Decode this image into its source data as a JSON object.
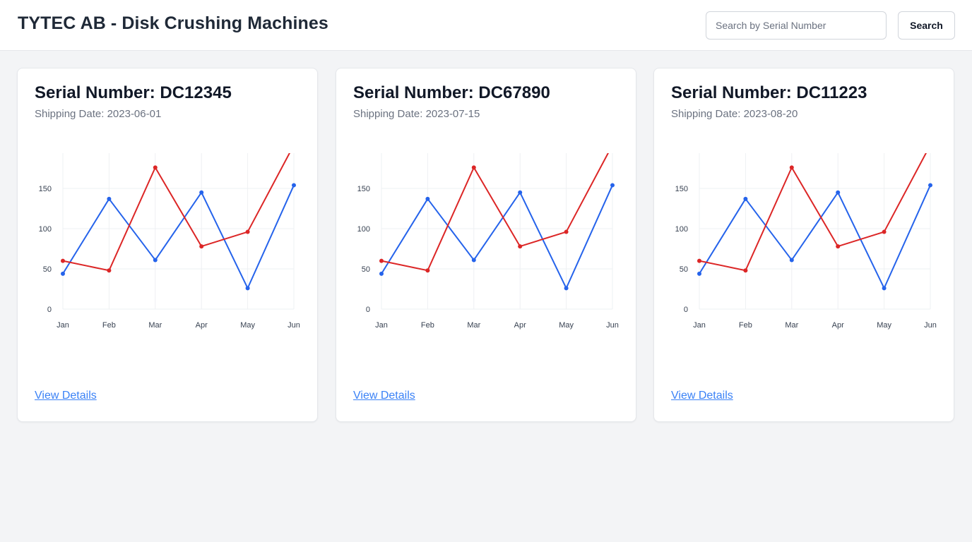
{
  "header": {
    "title": "TYTEC AB - Disk Crushing Machines",
    "search_placeholder": "Search by Serial Number",
    "search_value": "",
    "search_button": "Search"
  },
  "colors": {
    "series_blue": "#2563eb",
    "series_red": "#dc2626",
    "link": "#3b82f6"
  },
  "cards": [
    {
      "title": "Serial Number: DC12345",
      "shipping": "Shipping Date: 2023-06-01",
      "link": "View Details"
    },
    {
      "title": "Serial Number: DC67890",
      "shipping": "Shipping Date: 2023-07-15",
      "link": "View Details"
    },
    {
      "title": "Serial Number: DC11223",
      "shipping": "Shipping Date: 2023-08-20",
      "link": "View Details"
    }
  ],
  "chart_data": [
    {
      "type": "line",
      "categories": [
        "Jan",
        "Feb",
        "Mar",
        "Apr",
        "May",
        "Jun"
      ],
      "ylim": [
        0,
        200
      ],
      "yticks": [
        0,
        50,
        100,
        150,
        200
      ],
      "grid": true,
      "series": [
        {
          "color": "#2563eb",
          "values": [
            44,
            137,
            61,
            145,
            26,
            154
          ]
        },
        {
          "color": "#dc2626",
          "values": [
            60,
            48,
            176,
            78,
            96,
            204
          ]
        }
      ]
    },
    {
      "type": "line",
      "categories": [
        "Jan",
        "Feb",
        "Mar",
        "Apr",
        "May",
        "Jun"
      ],
      "ylim": [
        0,
        200
      ],
      "yticks": [
        0,
        50,
        100,
        150,
        200
      ],
      "grid": true,
      "series": [
        {
          "color": "#2563eb",
          "values": [
            44,
            137,
            61,
            145,
            26,
            154
          ]
        },
        {
          "color": "#dc2626",
          "values": [
            60,
            48,
            176,
            78,
            96,
            204
          ]
        }
      ]
    },
    {
      "type": "line",
      "categories": [
        "Jan",
        "Feb",
        "Mar",
        "Apr",
        "May",
        "Jun"
      ],
      "ylim": [
        0,
        200
      ],
      "yticks": [
        0,
        50,
        100,
        150,
        200
      ],
      "grid": true,
      "series": [
        {
          "color": "#2563eb",
          "values": [
            44,
            137,
            61,
            145,
            26,
            154
          ]
        },
        {
          "color": "#dc2626",
          "values": [
            60,
            48,
            176,
            78,
            96,
            204
          ]
        }
      ]
    }
  ]
}
